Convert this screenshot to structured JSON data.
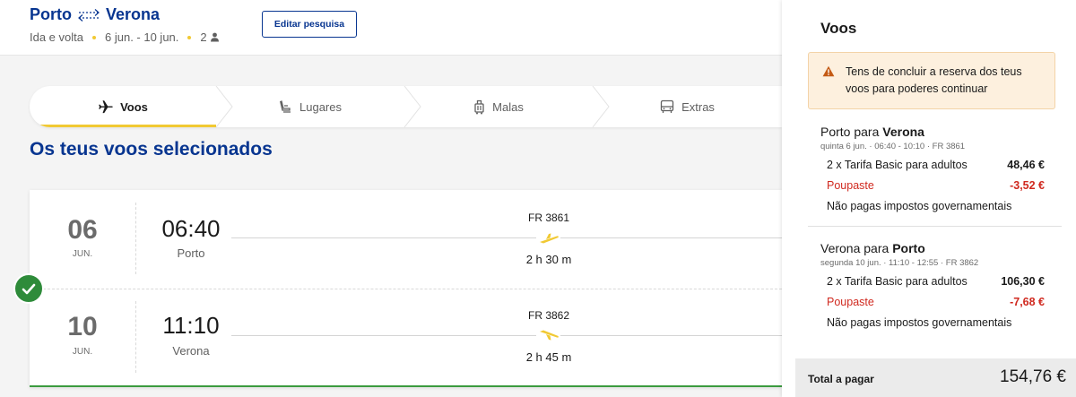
{
  "header": {
    "origin": "Porto",
    "destination": "Verona",
    "trip_type": "Ida e volta",
    "dates": "6 jun. - 10 jun.",
    "passengers": "2",
    "edit_label": "Editar pesquisa"
  },
  "steps": [
    {
      "label": "Voos",
      "icon": "plane-icon",
      "active": true
    },
    {
      "label": "Lugares",
      "icon": "seat-icon",
      "active": false
    },
    {
      "label": "Malas",
      "icon": "luggage-icon",
      "active": false
    },
    {
      "label": "Extras",
      "icon": "bus-icon",
      "active": false
    }
  ],
  "section_title": "Os teus voos selecionados",
  "flights": [
    {
      "day": "06",
      "month": "JUN.",
      "time": "06:40",
      "city": "Porto",
      "flight_no": "FR 3861",
      "duration": "2 h 30 m"
    },
    {
      "day": "10",
      "month": "JUN.",
      "time": "11:10",
      "city": "Verona",
      "flight_no": "FR 3862",
      "duration": "2 h 45 m"
    }
  ],
  "summary": {
    "title": "Voos",
    "warning": "Tens de concluir a reserva dos teus voos para poderes continuar",
    "segments": [
      {
        "from": "Porto",
        "connector": "para",
        "to": "Verona",
        "details": "quinta 6 jun.  ·  06:40 - 10:10  ·  FR 3861",
        "fare_label": "2 x Tarifa Basic para adultos",
        "fare_amount": "48,46 €",
        "saving_label": "Poupaste",
        "saving_amount": "-3,52 €",
        "tax_note": "Não pagas impostos governamentais"
      },
      {
        "from": "Verona",
        "connector": "para",
        "to": "Porto",
        "details": "segunda 10 jun.  ·  11:10 - 12:55  ·  FR 3862",
        "fare_label": "2 x Tarifa Basic para adultos",
        "fare_amount": "106,30 €",
        "saving_label": "Poupaste",
        "saving_amount": "-7,68 €",
        "tax_note": "Não pagas impostos governamentais"
      }
    ],
    "total_label": "Total a pagar",
    "total_value": "154,76 €"
  },
  "colors": {
    "brand_blue": "#073590",
    "accent_yellow": "#f1c933",
    "success_green": "#2e8b3a",
    "saving_red": "#d0291f"
  }
}
